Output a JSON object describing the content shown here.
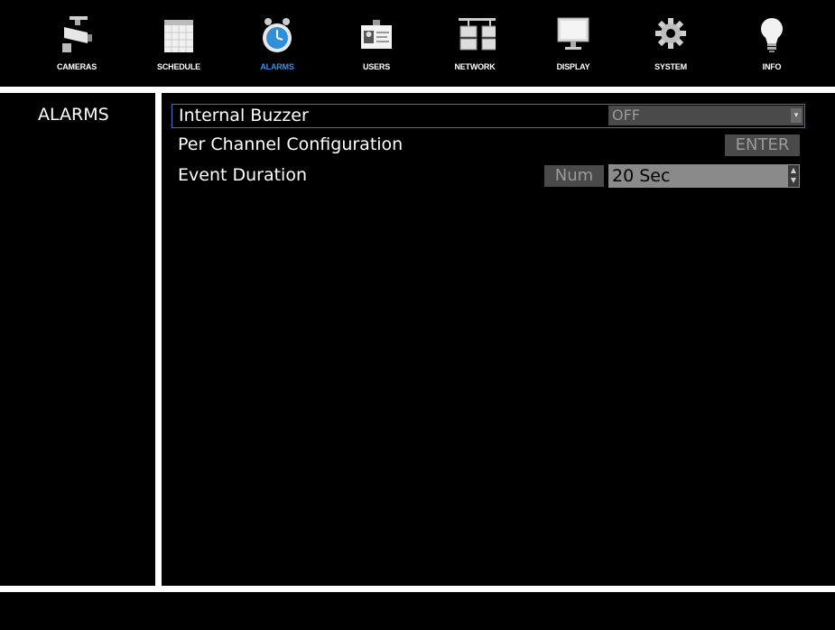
{
  "nav": {
    "tabs": [
      {
        "label": "CAMERAS",
        "icon": "camera-icon"
      },
      {
        "label": "SCHEDULE",
        "icon": "calendar-icon"
      },
      {
        "label": "ALARMS",
        "icon": "alarm-clock-icon",
        "active": true
      },
      {
        "label": "USERS",
        "icon": "id-card-icon"
      },
      {
        "label": "NETWORK",
        "icon": "network-icon"
      },
      {
        "label": "DISPLAY",
        "icon": "monitor-icon"
      },
      {
        "label": "SYSTEM",
        "icon": "gear-icon"
      },
      {
        "label": "INFO",
        "icon": "lightbulb-icon"
      }
    ],
    "active_color": "#3d8ee8"
  },
  "sidebar": {
    "title": "ALARMS"
  },
  "settings": {
    "internal_buzzer": {
      "label": "Internal Buzzer",
      "value": "OFF"
    },
    "per_channel": {
      "label": "Per Channel Configuration",
      "button": "ENTER"
    },
    "event_duration": {
      "label": "Event Duration",
      "num_button": "Num",
      "value": "20 Sec"
    }
  },
  "colors": {
    "selection_border": "#3a74c8",
    "control_bg": "#4a4a4a"
  }
}
